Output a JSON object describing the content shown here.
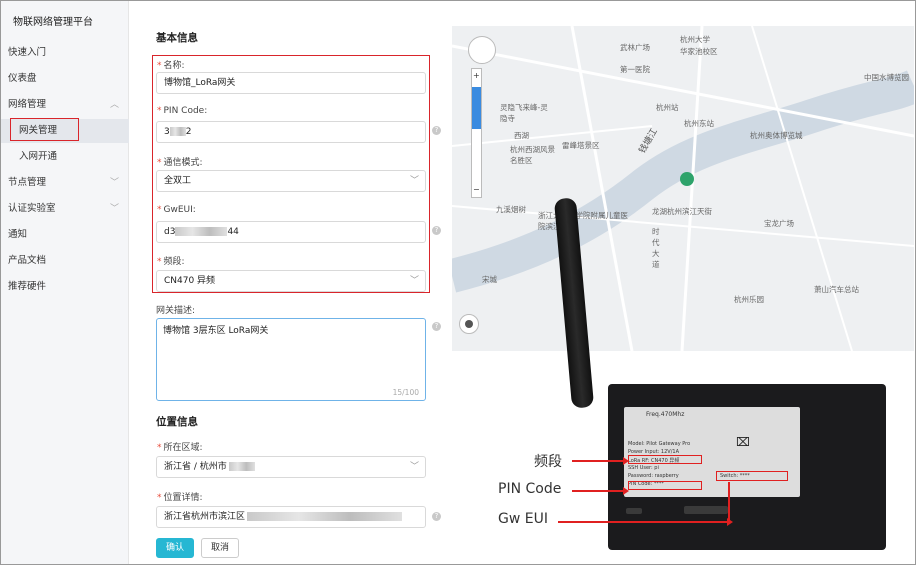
{
  "app": {
    "title": "物联网络管理平台"
  },
  "sidebar": {
    "items": [
      {
        "label": "快速入门",
        "expandable": false
      },
      {
        "label": "仪表盘",
        "expandable": false
      },
      {
        "label": "网络管理",
        "expandable": true,
        "expanded": true
      },
      {
        "label": "网关管理",
        "sub": true,
        "active": true
      },
      {
        "label": "入网开通",
        "sub": true
      },
      {
        "label": "节点管理",
        "expandable": true
      },
      {
        "label": "认证实验室",
        "expandable": true
      },
      {
        "label": "通知"
      },
      {
        "label": "产品文档"
      },
      {
        "label": "推荐硬件"
      }
    ]
  },
  "form": {
    "basic_title": "基本信息",
    "name": {
      "label": "名称:",
      "value": "博物馆_LoRa网关"
    },
    "pin": {
      "label": "PIN Code:",
      "value_start": "3",
      "value_end": "2"
    },
    "mode": {
      "label": "通信模式:",
      "value": "全双工"
    },
    "gweui": {
      "label": "GwEUI:",
      "value_start": "d3",
      "value_end": "44"
    },
    "band": {
      "label": "频段:",
      "value": "CN470 异频"
    },
    "desc": {
      "label": "网关描述:",
      "value": "博物馆 3层东区 LoRa网关",
      "counter": "15/100"
    },
    "location_title": "位置信息",
    "region": {
      "label": "所在区域:",
      "value": "浙江省 / 杭州市"
    },
    "address": {
      "label": "位置详情:",
      "value": "浙江省杭州市滨江区"
    },
    "confirm": "确认",
    "cancel": "取消"
  },
  "map": {
    "labels": [
      "武林广场",
      "杭州大学",
      "华家池校区",
      "第一医院",
      "杭州站",
      "灵隐飞来峰-灵隐寺",
      "西湖",
      "杭州西湖风景名胜区",
      "雷峰塔景区",
      "杭州东站",
      "钱塘江",
      "中国水博览园",
      "杭州奥体博览城",
      "九溪烟树",
      "浙江大学医学院附属儿童医院滨江院区",
      "龙湖杭州滨江天街",
      "时代大道",
      "宝龙广场",
      "宋城",
      "杭州乐园",
      "萧山汽车总站",
      "杭州乐园"
    ]
  },
  "device": {
    "sticker": [
      "Freq.470Mhz",
      "Model: Pilot Gateway Pro",
      "Power Input: 12V/1A",
      "LoRa RF: CN470 异频",
      "SSH User: pi",
      "Password: raspberry",
      "PIN Code: ****",
      "Switch: ****"
    ],
    "callouts": [
      "频段",
      "PIN Code",
      "Gw EUI"
    ]
  },
  "colors": {
    "accent": "#26b7d3",
    "highlight": "#d9252b",
    "required": "#e74c3c"
  }
}
